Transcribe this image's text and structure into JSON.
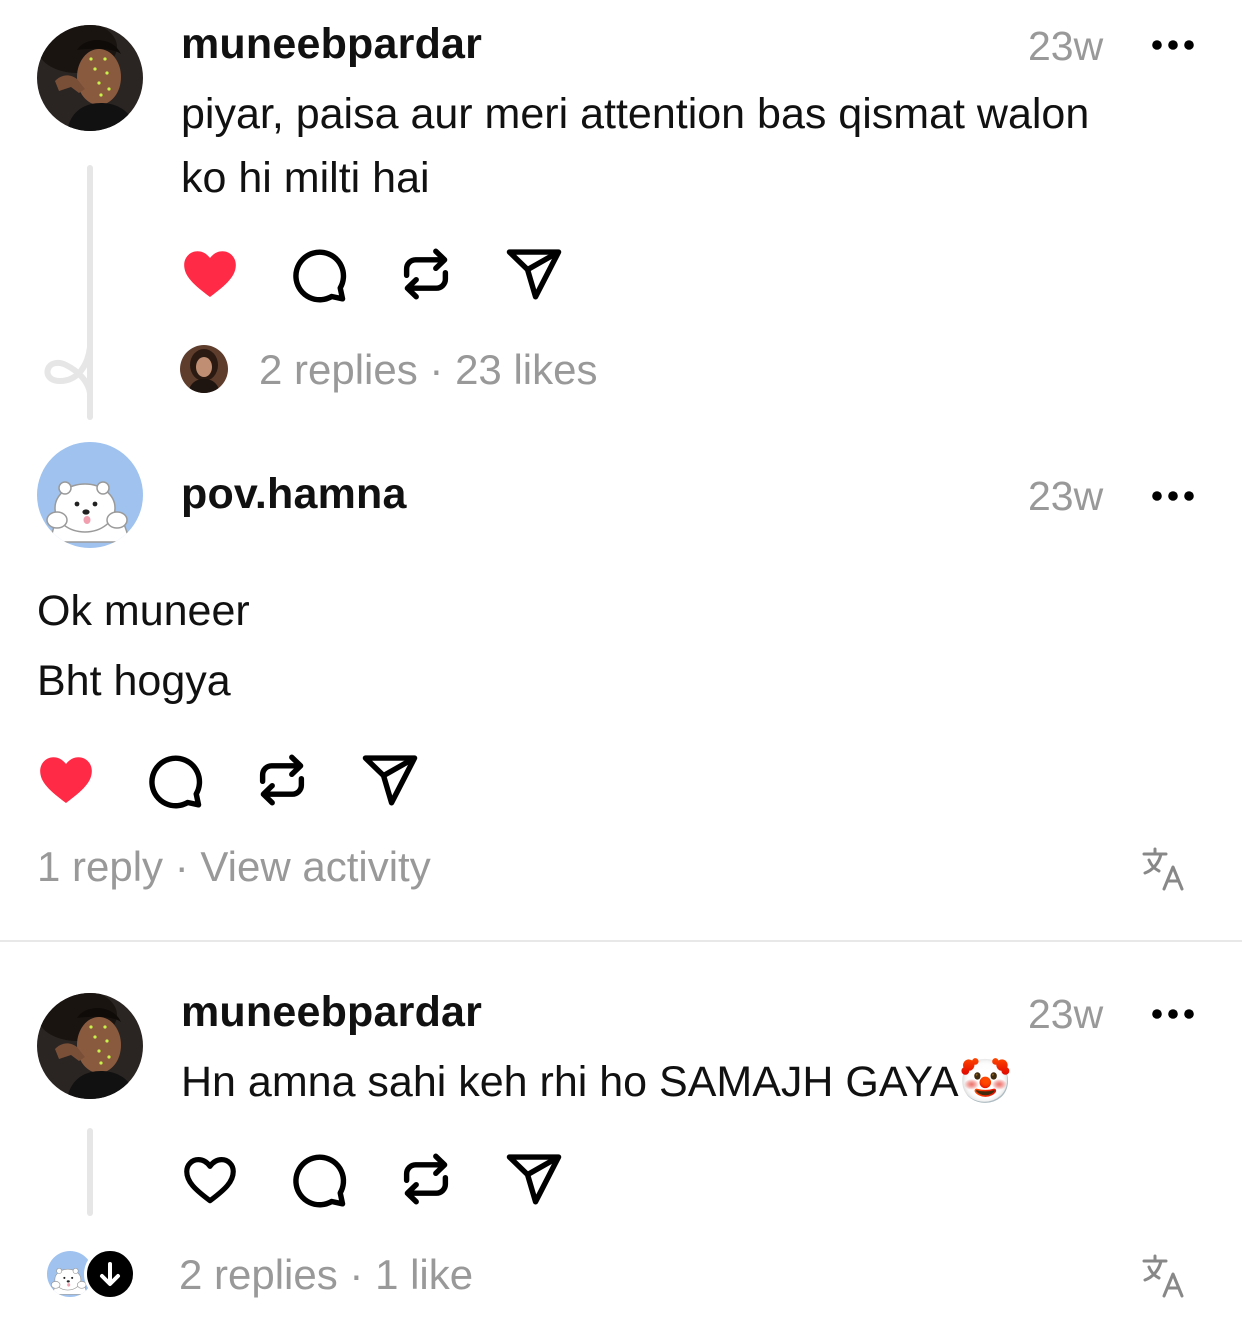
{
  "colors": {
    "like_red": "#ff2a45",
    "muted": "#999999",
    "text": "#111111",
    "thread_line": "#e6e6e6"
  },
  "posts": [
    {
      "username": "muneebpardar",
      "time": "23w",
      "text_lines": [
        "piyar, paisa aur meri attention bas qismat walon",
        "ko hi milti hai"
      ],
      "liked": true,
      "meta": "2 replies · 23 likes",
      "icons": [
        "heart-filled-icon",
        "comment-icon",
        "repost-icon",
        "share-icon",
        "more-icon"
      ]
    },
    {
      "username": "pov.hamna",
      "time": "23w",
      "text_lines": [
        "Ok muneer",
        "Bht hogya"
      ],
      "liked": true,
      "meta": "1 reply · View activity",
      "icons": [
        "heart-filled-icon",
        "comment-icon",
        "repost-icon",
        "share-icon",
        "more-icon",
        "translate-icon"
      ]
    },
    {
      "username": "muneebpardar",
      "time": "23w",
      "text": "Hn amna sahi keh rhi ho SAMAJH GAYA",
      "emoji": "🤡",
      "liked": false,
      "meta": "2 replies · 1 like",
      "icons": [
        "heart-outline-icon",
        "comment-icon",
        "repost-icon",
        "share-icon",
        "more-icon",
        "translate-icon",
        "arrow-down-icon"
      ]
    }
  ]
}
